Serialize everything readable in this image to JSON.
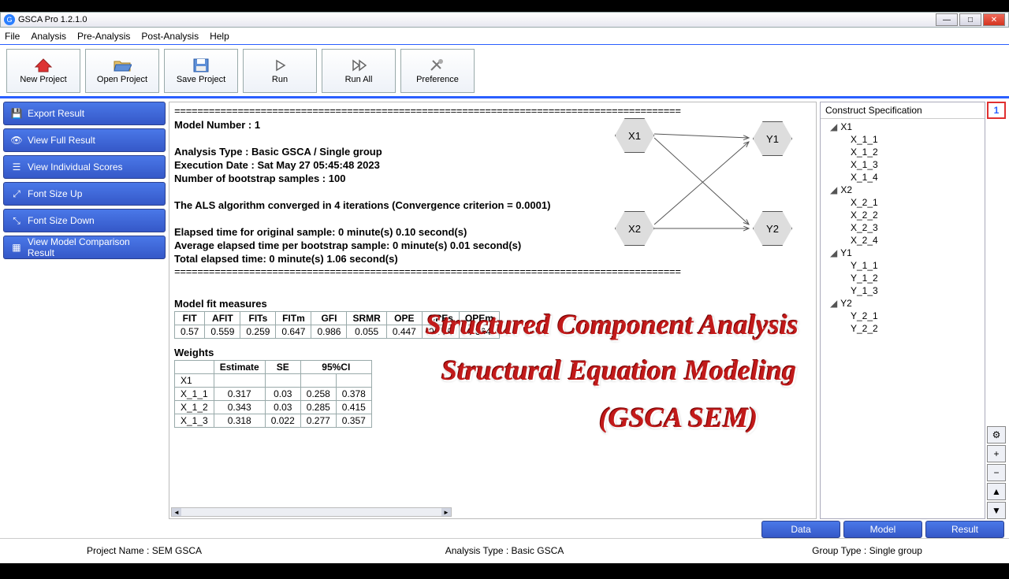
{
  "window": {
    "title": "GSCA Pro 1.2.1.0"
  },
  "menu": [
    "File",
    "Analysis",
    "Pre-Analysis",
    "Post-Analysis",
    "Help"
  ],
  "toolbar": [
    {
      "id": "new-project",
      "label": "New Project",
      "icon": "home"
    },
    {
      "id": "open-project",
      "label": "Open Project",
      "icon": "folder"
    },
    {
      "id": "save-project",
      "label": "Save Project",
      "icon": "disk"
    },
    {
      "id": "run",
      "label": "Run",
      "icon": "play"
    },
    {
      "id": "run-all",
      "label": "Run All",
      "icon": "playall"
    },
    {
      "id": "preference",
      "label": "Preference",
      "icon": "tools"
    }
  ],
  "sidebar": [
    {
      "id": "export-result",
      "label": "Export Result"
    },
    {
      "id": "view-full",
      "label": "View Full Result"
    },
    {
      "id": "view-scores",
      "label": "View Individual Scores"
    },
    {
      "id": "font-up",
      "label": "Font Size Up"
    },
    {
      "id": "font-down",
      "label": "Font Size Down"
    },
    {
      "id": "model-comp",
      "label": "View Model Comparison Result"
    }
  ],
  "result": {
    "divider": "========================================================================================",
    "model_number": "Model Number : 1",
    "analysis_type": "Analysis Type : Basic GSCA / Single group",
    "execution_date": "Execution Date : Sat May 27 05:45:48 2023",
    "bootstrap": "Number of bootstrap samples : 100",
    "convergence": "The ALS algorithm converged in 4 iterations (Convergence criterion = 0.0001)",
    "elapsed_orig": "Elapsed time for original sample:   0 minute(s) 0.10 second(s)",
    "elapsed_avg": "Average elapsed time per bootstrap sample:   0 minute(s) 0.01 second(s)",
    "elapsed_total": "Total elapsed time:   0 minute(s) 1.06 second(s)",
    "fit_title": "Model fit measures",
    "weights_title": "Weights"
  },
  "chart_data": {
    "type": "table",
    "tables": [
      {
        "name": "Model fit measures",
        "headers": [
          "FIT",
          "AFIT",
          "FITs",
          "FITm",
          "GFI",
          "SRMR",
          "OPE",
          "OPEs",
          "OPEm"
        ],
        "rows": [
          [
            "0.57",
            "0.559",
            "0.259",
            "0.647",
            "0.986",
            "0.055",
            "0.447",
            "0.779",
            "0.364"
          ]
        ]
      },
      {
        "name": "Weights",
        "headers": [
          "",
          "Estimate",
          "SE",
          "95%CI_low",
          "95%CI_high"
        ],
        "rows": [
          [
            "X1",
            "",
            "",
            "",
            ""
          ],
          [
            "X_1_1",
            "0.317",
            "0.03",
            "0.258",
            "0.378"
          ],
          [
            "X_1_2",
            "0.343",
            "0.03",
            "0.285",
            "0.415"
          ],
          [
            "X_1_3",
            "0.318",
            "0.022",
            "0.277",
            "0.357"
          ]
        ]
      }
    ],
    "diagram": {
      "nodes": [
        "X1",
        "X2",
        "Y1",
        "Y2"
      ],
      "edges": [
        [
          "X1",
          "Y1"
        ],
        [
          "X1",
          "Y2"
        ],
        [
          "X2",
          "Y1"
        ],
        [
          "X2",
          "Y2"
        ]
      ]
    }
  },
  "watermark": {
    "l1": "Structured Component Analysis",
    "l2": "Structural Equation Modeling",
    "l3": "(GSCA SEM)"
  },
  "construct": {
    "title": "Construct Specification",
    "groups": [
      {
        "name": "X1",
        "items": [
          "X_1_1",
          "X_1_2",
          "X_1_3",
          "X_1_4"
        ]
      },
      {
        "name": "X2",
        "items": [
          "X_2_1",
          "X_2_2",
          "X_2_3",
          "X_2_4"
        ]
      },
      {
        "name": "Y1",
        "items": [
          "Y_1_1",
          "Y_1_2",
          "Y_1_3"
        ]
      },
      {
        "name": "Y2",
        "items": [
          "Y_2_1",
          "Y_2_2"
        ]
      }
    ]
  },
  "right_controls": {
    "counter": "1",
    "plus": "+",
    "minus": "−",
    "up": "▲",
    "down": "▼"
  },
  "tabs": [
    "Data",
    "Model",
    "Result"
  ],
  "status": {
    "project": "Project Name : SEM GSCA",
    "analysis": "Analysis Type : Basic GSCA",
    "group": "Group Type : Single group"
  }
}
